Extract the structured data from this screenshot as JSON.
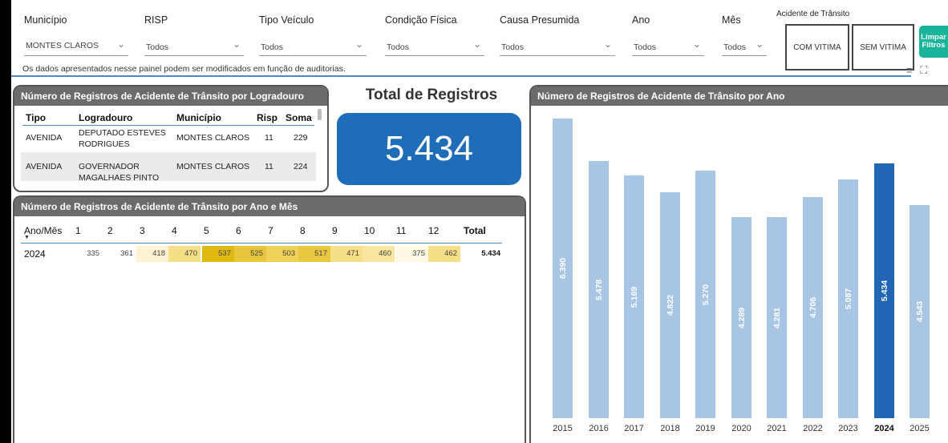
{
  "filters": [
    {
      "label": "Município",
      "value": "MONTES CLAROS"
    },
    {
      "label": "RISP",
      "value": "Todos"
    },
    {
      "label": "Tipo Veículo",
      "value": "Todos"
    },
    {
      "label": "Condição Física",
      "value": "Todos"
    },
    {
      "label": "Causa Presumida",
      "value": "Todos"
    },
    {
      "label": "Ano",
      "value": "Todos"
    },
    {
      "label": "Mês",
      "value": "Todos"
    }
  ],
  "accident_filter": {
    "label": "Acidente de Trânsito",
    "with_victim": "COM VITIMA",
    "without_victim": "SEM VITIMA"
  },
  "clear_button": {
    "line1": "Limpar",
    "line2": "Filtros"
  },
  "note": "Os dados apresentados nesse painel podem ser modificados em função de auditorias.",
  "logradouro_table": {
    "title": "Número de Registros de Acidente de Trânsito por Logradouro",
    "headers": [
      "Tipo",
      "Logradouro",
      "Município",
      "Risp",
      "Soma"
    ],
    "rows": [
      {
        "tipo": "AVENIDA",
        "logradouro_1": "DEPUTADO ESTEVES",
        "logradouro_2": "RODRIGUES",
        "municipio": "MONTES CLAROS",
        "risp": "11",
        "soma": "229"
      },
      {
        "tipo": "AVENIDA",
        "logradouro_1": "GOVERNADOR",
        "logradouro_2": "MAGALHAES PINTO",
        "municipio": "MONTES CLAROS",
        "risp": "11",
        "soma": "224"
      }
    ]
  },
  "total_card": {
    "title": "Total de Registros",
    "value": "5.434"
  },
  "month_table": {
    "title": "Número de Registros de Acidente de Trânsito por Ano e Mês",
    "row_header": "Ano/Mês",
    "months": [
      "1",
      "2",
      "3",
      "4",
      "5",
      "6",
      "7",
      "8",
      "9",
      "10",
      "11",
      "12"
    ],
    "total_header": "Total",
    "year": "2024",
    "values": [
      335,
      361,
      418,
      470,
      537,
      525,
      503,
      517,
      471,
      460,
      375,
      462
    ],
    "total": "5.434",
    "colors": [
      "#ffffff",
      "#ffffff",
      "#fdf3d2",
      "#f6df86",
      "#e0b90f",
      "#e8c53a",
      "#f0d258",
      "#e9c73f",
      "#f6df86",
      "#f8e69e",
      "#fef9e4",
      "#f6df86"
    ]
  },
  "year_chart": {
    "title": "Número de Registros de Acidente de Trânsito por Ano",
    "chart_data": {
      "type": "bar",
      "categories": [
        "2015",
        "2016",
        "2017",
        "2018",
        "2019",
        "2020",
        "2021",
        "2022",
        "2023",
        "2024",
        "2025"
      ],
      "values": [
        6390,
        5478,
        5169,
        4822,
        5270,
        4289,
        4281,
        4706,
        5087,
        5434,
        4543
      ],
      "labels": [
        "6.390",
        "5.478",
        "5.169",
        "4.822",
        "5.270",
        "4.289",
        "4.281",
        "4.706",
        "5.087",
        "5.434",
        "4.543"
      ],
      "selected": "2024",
      "colors": {
        "bar": "#a8c6e4",
        "selected": "#2166b5"
      }
    }
  }
}
